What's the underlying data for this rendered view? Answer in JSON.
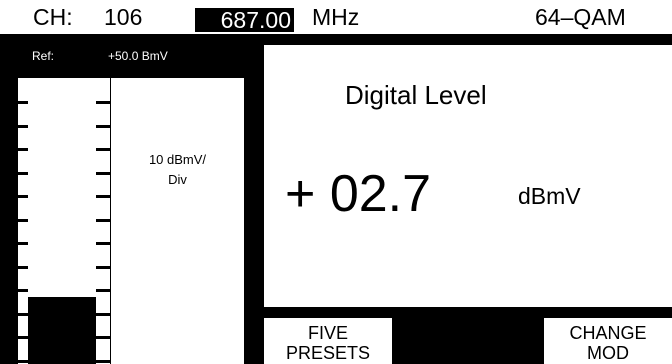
{
  "header": {
    "channel_label": "CH:",
    "channel_number": "106",
    "frequency": "687.00",
    "frequency_unit": "MHz",
    "modulation": "64–QAM"
  },
  "meter": {
    "ref_label": "Ref:",
    "ref_value": "+50.0 BmV",
    "scale_line1": "10 dBmV/",
    "scale_line2": "Div",
    "bar_level_fraction": 0.5
  },
  "display": {
    "title": "Digital Level",
    "value": "+ 02.7",
    "unit": "dBmV"
  },
  "softkeys": {
    "five_presets_line1": "FIVE",
    "five_presets_line2": "PRESETS",
    "change_mod_line1": "CHANGE",
    "change_mod_line2": "MOD"
  }
}
